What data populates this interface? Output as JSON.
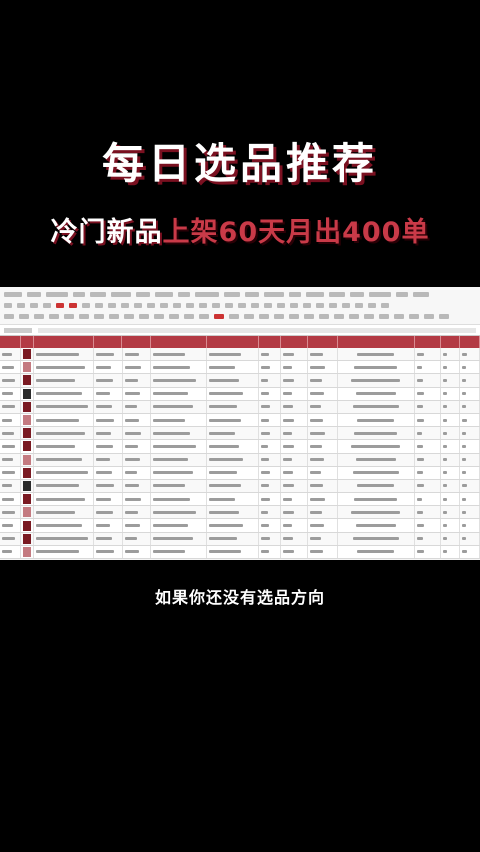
{
  "title": "每日选品推荐",
  "subtitle_white": "冷门新品",
  "subtitle_red": "上架60天月出400单",
  "caption": "如果你还没有选品方向",
  "colors": {
    "accent": "#b33a44",
    "title_shadow": "#7a1020",
    "background": "#000000"
  }
}
